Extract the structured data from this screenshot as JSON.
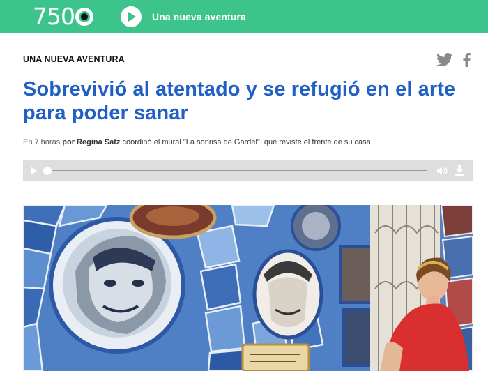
{
  "header": {
    "logo_text": "750",
    "radio_title": "Una nueva aventura",
    "play_icon": "play-icon",
    "brand_color": "#3dc38c"
  },
  "article": {
    "kicker": "UNA NUEVA AVENTURA",
    "title": "Sobrevivió al atentado y se refugió en el arte para poder sanar",
    "time": "En 7 horas",
    "author": "por Regina Satz",
    "summary": "coordinó el mural \"La sonrisa de Gardel\", que reviste el frente de su casa",
    "title_color": "#2060c4"
  },
  "social": {
    "twitter_icon": "twitter-icon",
    "facebook_icon": "facebook-icon"
  },
  "player": {
    "play_icon": "play-icon",
    "volume_icon": "volume-icon",
    "download_icon": "download-icon",
    "progress": 0
  },
  "photo": {
    "description_icon": "mosaic-mural-photo"
  }
}
